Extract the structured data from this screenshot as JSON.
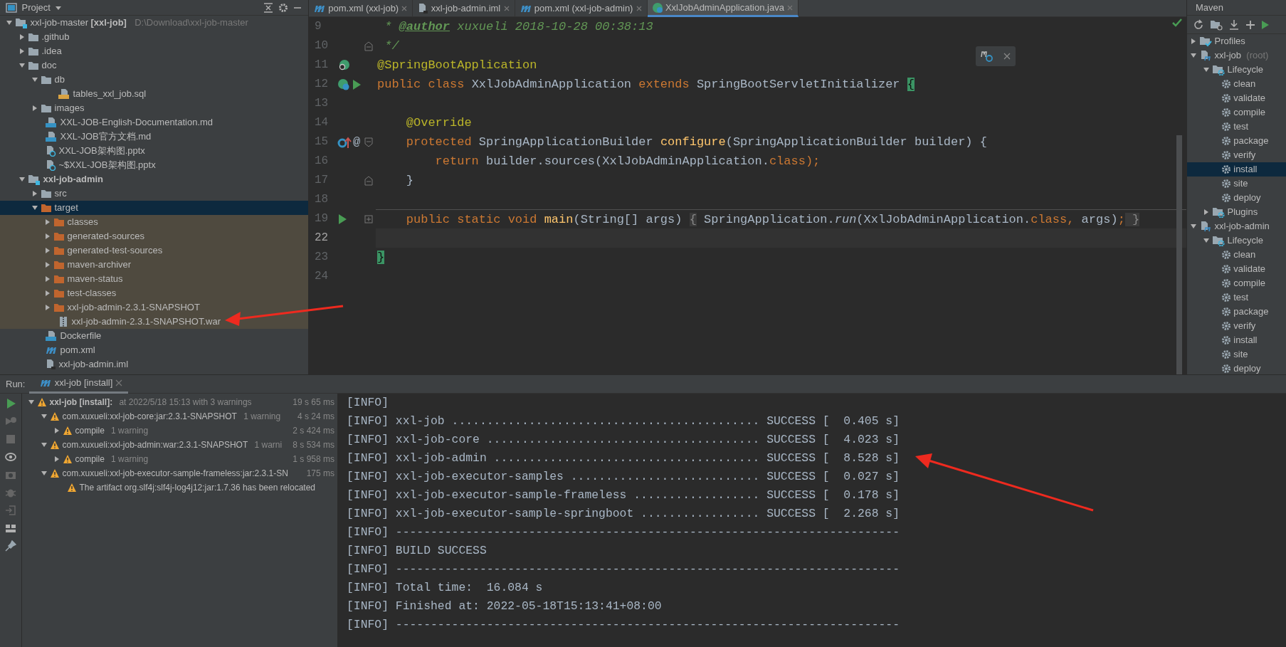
{
  "project_panel": {
    "title": "Project",
    "tree": [
      {
        "label": "xxl-job-master",
        "tag": "[xxl-job]",
        "path": "D:\\Download\\xxl-job-master",
        "kind": "module",
        "expanded": true,
        "selected": false,
        "children": [
          {
            "label": ".github",
            "kind": "folder",
            "expanded": false,
            "selected": false
          },
          {
            "label": ".idea",
            "kind": "folder",
            "expanded": false,
            "selected": false
          },
          {
            "label": "doc",
            "kind": "folder",
            "expanded": true,
            "selected": false,
            "children": [
              {
                "label": "db",
                "kind": "folder",
                "expanded": true,
                "selected": false,
                "children": [
                  {
                    "label": "tables_xxl_job.sql",
                    "kind": "sql",
                    "selected": false
                  }
                ]
              },
              {
                "label": "images",
                "kind": "folder",
                "expanded": false,
                "selected": false
              },
              {
                "label": "XXL-JOB-English-Documentation.md",
                "kind": "md",
                "selected": false
              },
              {
                "label": "XXL-JOB官方文档.md",
                "kind": "md",
                "selected": false
              },
              {
                "label": "XXL-JOB架构图.pptx",
                "kind": "unknown",
                "selected": false
              },
              {
                "label": "~$XXL-JOB架构图.pptx",
                "kind": "unknown",
                "selected": false
              }
            ]
          },
          {
            "label": "xxl-job-admin",
            "kind": "module",
            "bold": true,
            "expanded": true,
            "selected": false,
            "children": [
              {
                "label": "src",
                "kind": "folder",
                "expanded": false,
                "selected": false
              },
              {
                "label": "target",
                "kind": "folder",
                "excluded": true,
                "expanded": true,
                "selected": true,
                "children": [
                  {
                    "label": "classes",
                    "kind": "folder",
                    "expanded": false,
                    "selected": false
                  },
                  {
                    "label": "generated-sources",
                    "kind": "folder",
                    "expanded": false,
                    "selected": false
                  },
                  {
                    "label": "generated-test-sources",
                    "kind": "folder",
                    "expanded": false,
                    "selected": false
                  },
                  {
                    "label": "maven-archiver",
                    "kind": "folder",
                    "expanded": false,
                    "selected": false
                  },
                  {
                    "label": "maven-status",
                    "kind": "folder",
                    "expanded": false,
                    "selected": false
                  },
                  {
                    "label": "test-classes",
                    "kind": "folder",
                    "expanded": false,
                    "selected": false
                  },
                  {
                    "label": "xxl-job-admin-2.3.1-SNAPSHOT",
                    "kind": "folder",
                    "expanded": false,
                    "selected": false
                  },
                  {
                    "label": "xxl-job-admin-2.3.1-SNAPSHOT.war",
                    "kind": "archive",
                    "selected": false
                  }
                ]
              },
              {
                "label": "Dockerfile",
                "kind": "docker",
                "selected": false
              },
              {
                "label": "pom.xml",
                "kind": "pom",
                "selected": false
              },
              {
                "label": "xxl-job-admin.iml",
                "kind": "iml",
                "selected": false
              }
            ]
          }
        ]
      }
    ]
  },
  "editor": {
    "tabs": [
      {
        "label": "pom.xml (xxl-job)",
        "kind": "pom",
        "selected": false
      },
      {
        "label": "xxl-job-admin.iml",
        "kind": "iml",
        "selected": false
      },
      {
        "label": "pom.xml (xxl-job-admin)",
        "kind": "pom",
        "selected": false
      },
      {
        "label": "XxlJobAdminApplication.java",
        "kind": "java",
        "selected": true
      }
    ],
    "lines": [
      {
        "number": "9",
        "tokens": [
          {
            "text": " * ",
            "kind": "comment"
          },
          {
            "text": "@author",
            "kind": "doctag"
          },
          {
            "text": " xuxueli 2018-10-28 00:38:13",
            "kind": "comment"
          }
        ]
      },
      {
        "number": "10",
        "fold": {
          "kind": "end"
        },
        "tokens": [
          {
            "text": " */",
            "kind": "comment"
          }
        ]
      },
      {
        "number": "11",
        "gutter": [
          {
            "kind": "bean"
          }
        ],
        "tokens": [
          {
            "text": "@SpringBootApplication",
            "kind": "annotation"
          }
        ]
      },
      {
        "number": "12",
        "gutter": [
          {
            "kind": "spring"
          },
          {
            "kind": "run"
          }
        ],
        "tokens": [
          {
            "text": "public class ",
            "kind": "keyword"
          },
          {
            "text": "XxlJobAdminApplication ",
            "kind": "plain"
          },
          {
            "text": "extends ",
            "kind": "keyword"
          },
          {
            "text": "SpringBootServletInitializer ",
            "kind": "plain"
          },
          {
            "text": "{",
            "kind": "brace"
          }
        ]
      },
      {
        "number": "13"
      },
      {
        "number": "14",
        "tokens": [
          {
            "text": "    @Override",
            "kind": "annotation"
          }
        ]
      },
      {
        "number": "15",
        "gutter": [
          {
            "kind": "override"
          }
        ],
        "gutter_text": "@",
        "fold": {
          "kind": "start"
        },
        "tokens": [
          {
            "text": "    protected ",
            "kind": "keyword"
          },
          {
            "text": "SpringApplicationBuilder ",
            "kind": "plain"
          },
          {
            "text": "configure",
            "kind": "method"
          },
          {
            "text": "(SpringApplicationBuilder builder) {",
            "kind": "plain"
          }
        ]
      },
      {
        "number": "16",
        "tokens": [
          {
            "text": "        return ",
            "kind": "keyword"
          },
          {
            "text": "builder.sources(XxlJobAdminApplication.",
            "kind": "plain"
          },
          {
            "text": "class",
            "kind": "keyword"
          },
          {
            "text": ");",
            "kind": "keyword"
          }
        ]
      },
      {
        "number": "17",
        "fold": {
          "kind": "end"
        },
        "tokens": [
          {
            "text": "    }",
            "kind": "plain"
          }
        ]
      },
      {
        "number": "18"
      },
      {
        "number": "19",
        "gutter": [
          {
            "kind": "run"
          }
        ],
        "fold": {
          "kind": "collapsed"
        },
        "separator": true,
        "tokens": [
          {
            "text": "    public static void ",
            "kind": "keyword"
          },
          {
            "text": "main",
            "kind": "method"
          },
          {
            "text": "(String[] args) ",
            "kind": "plain"
          },
          {
            "text": "{",
            "kind": "folded"
          },
          {
            "text": " SpringApplication.",
            "kind": "plain"
          },
          {
            "text": "run",
            "kind": "italic"
          },
          {
            "text": "(XxlJobAdminApplication.",
            "kind": "plain"
          },
          {
            "text": "class",
            "kind": "keyword"
          },
          {
            "text": ", ",
            "kind": "keyword"
          },
          {
            "text": "args)",
            "kind": "plain"
          },
          {
            "text": ";",
            "kind": "keyword"
          },
          {
            "text": " }",
            "kind": "folded"
          }
        ]
      },
      {
        "number": "22",
        "current": true
      },
      {
        "number": "23",
        "tokens": [
          {
            "text": "}",
            "kind": "brace"
          }
        ]
      },
      {
        "number": "24"
      }
    ]
  },
  "maven_panel": {
    "title": "Maven",
    "tree": [
      {
        "label": "Profiles",
        "kind": "profiles",
        "expanded": false,
        "selected": false
      },
      {
        "label": "xxl-job",
        "note": "(root)",
        "kind": "project",
        "expanded": true,
        "selected": false,
        "children": [
          {
            "label": "Lifecycle",
            "kind": "lifecycle",
            "expanded": true,
            "selected": false,
            "children": [
              {
                "label": "clean",
                "kind": "goal",
                "selected": false
              },
              {
                "label": "validate",
                "kind": "goal",
                "selected": false
              },
              {
                "label": "compile",
                "kind": "goal",
                "selected": false
              },
              {
                "label": "test",
                "kind": "goal",
                "selected": false
              },
              {
                "label": "package",
                "kind": "goal",
                "selected": false
              },
              {
                "label": "verify",
                "kind": "goal",
                "selected": false
              },
              {
                "label": "install",
                "kind": "goal",
                "selected": true
              },
              {
                "label": "site",
                "kind": "goal",
                "selected": false
              },
              {
                "label": "deploy",
                "kind": "goal",
                "selected": false
              }
            ]
          },
          {
            "label": "Plugins",
            "kind": "lifecycle",
            "expanded": false,
            "selected": false
          }
        ]
      },
      {
        "label": "xxl-job-admin",
        "kind": "project",
        "expanded": true,
        "selected": false,
        "children": [
          {
            "label": "Lifecycle",
            "kind": "lifecycle",
            "expanded": true,
            "selected": false,
            "children": [
              {
                "label": "clean",
                "kind": "goal",
                "selected": false
              },
              {
                "label": "validate",
                "kind": "goal",
                "selected": false
              },
              {
                "label": "compile",
                "kind": "goal",
                "selected": false
              },
              {
                "label": "test",
                "kind": "goal",
                "selected": false
              },
              {
                "label": "package",
                "kind": "goal",
                "selected": false
              },
              {
                "label": "verify",
                "kind": "goal",
                "selected": false
              },
              {
                "label": "install",
                "kind": "goal",
                "selected": false
              },
              {
                "label": "site",
                "kind": "goal",
                "selected": false
              },
              {
                "label": "deploy",
                "kind": "goal",
                "selected": false
              }
            ]
          }
        ]
      }
    ]
  },
  "run_panel": {
    "label": "Run:",
    "tab": "xxl-job [install]",
    "tree": [
      {
        "label": "xxl-job [install]:",
        "bold": true,
        "detail": "at 2022/5/18 15:13 with 3 warnings",
        "time": "19 s 65 ms",
        "expanded": true,
        "children": [
          {
            "label": "com.xuxueli:xxl-job-core:jar:2.3.1-SNAPSHOT",
            "detail": "1 warning",
            "time": "4 s 24 ms",
            "expanded": true,
            "children": [
              {
                "label": "compile",
                "detail": "1 warning",
                "time": "2 s 424 ms",
                "expanded": false
              }
            ]
          },
          {
            "label": "com.xuxueli:xxl-job-admin:war:2.3.1-SNAPSHOT",
            "detail": "1 warni",
            "time": "8 s 534 ms",
            "expanded": true,
            "children": [
              {
                "label": "compile",
                "detail": "1 warning",
                "time": "1 s 958 ms",
                "expanded": false
              }
            ]
          },
          {
            "label": "com.xuxueli:xxl-job-executor-sample-frameless:jar:2.3.1-SN",
            "time": "175 ms",
            "expanded": true,
            "children": [
              {
                "label": "The artifact org.slf4j:slf4j-log4j12:jar:1.7.36 has been relocated"
              }
            ]
          }
        ]
      }
    ],
    "console": [
      "[INFO]",
      "[INFO] xxl-job ............................................ SUCCESS [  0.405 s]",
      "[INFO] xxl-job-core ....................................... SUCCESS [  4.023 s]",
      "[INFO] xxl-job-admin ...................................... SUCCESS [  8.528 s]",
      "[INFO] xxl-job-executor-samples ........................... SUCCESS [  0.027 s]",
      "[INFO] xxl-job-executor-sample-frameless .................. SUCCESS [  0.178 s]",
      "[INFO] xxl-job-executor-sample-springboot ................. SUCCESS [  2.268 s]",
      "[INFO] ------------------------------------------------------------------------",
      "[INFO] BUILD SUCCESS",
      "[INFO] ------------------------------------------------------------------------",
      "[INFO] Total time:  16.084 s",
      "[INFO] Finished at: 2022-05-18T15:13:41+08:00",
      "[INFO] ------------------------------------------------------------------------"
    ]
  }
}
